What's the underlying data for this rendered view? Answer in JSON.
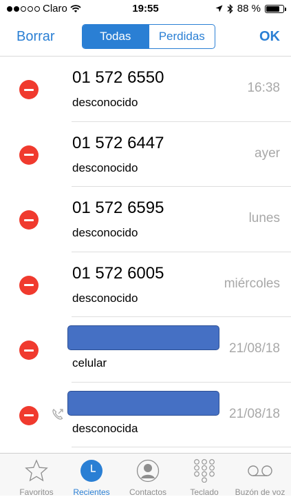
{
  "status_bar": {
    "carrier": "Claro",
    "time": "19:55",
    "battery_text": "88 %",
    "battery_level": 0.88,
    "signal_bars_filled": 2,
    "signal_bars_total": 5
  },
  "nav": {
    "edit_label": "Borrar",
    "done_label": "OK",
    "segments": [
      {
        "label": "Todas",
        "active": true
      },
      {
        "label": "Perdidas",
        "active": false
      }
    ]
  },
  "calls": [
    {
      "number": "01 572 6550",
      "type": "desconocido",
      "time": "16:38",
      "redacted": false,
      "outgoing": false
    },
    {
      "number": "01 572 6447",
      "type": "desconocido",
      "time": "ayer",
      "redacted": false,
      "outgoing": false
    },
    {
      "number": "01 572 6595",
      "type": "desconocido",
      "time": "lunes",
      "redacted": false,
      "outgoing": false
    },
    {
      "number": "01 572 6005",
      "type": "desconocido",
      "time": "miércoles",
      "redacted": false,
      "outgoing": false
    },
    {
      "number": "",
      "type": "celular",
      "time": "21/08/18",
      "redacted": true,
      "outgoing": false
    },
    {
      "number": "",
      "type": "desconocida",
      "time": "21/08/18",
      "redacted": true,
      "outgoing": true
    }
  ],
  "tabs": [
    {
      "label": "Favoritos",
      "icon": "star-icon",
      "active": false
    },
    {
      "label": "Recientes",
      "icon": "clock-icon",
      "active": true
    },
    {
      "label": "Contactos",
      "icon": "contact-icon",
      "active": false
    },
    {
      "label": "Teclado",
      "icon": "keypad-icon",
      "active": false
    },
    {
      "label": "Buzón de voz",
      "icon": "voicemail-icon",
      "active": false
    }
  ],
  "colors": {
    "accent": "#2a7fd4",
    "delete": "#f03a2e",
    "secondary_text": "#a8a8a8",
    "redaction": "#4570c4",
    "tab_inactive": "#8e8e8e"
  }
}
